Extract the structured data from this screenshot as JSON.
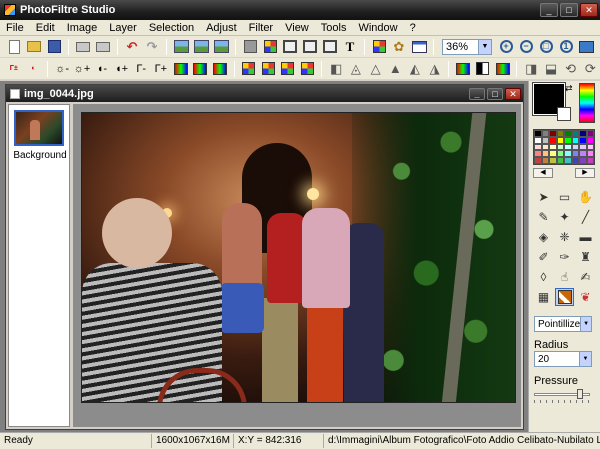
{
  "window": {
    "title": "PhotoFiltre Studio"
  },
  "menu": [
    "File",
    "Edit",
    "Image",
    "Layer",
    "Selection",
    "Adjust",
    "Filter",
    "View",
    "Tools",
    "Window",
    "?"
  ],
  "toolbar": {
    "zoom_value": "36%"
  },
  "document": {
    "title": "img_0044.jpg"
  },
  "layers": [
    {
      "label": "Background"
    }
  ],
  "right_panel": {
    "filter_select": "Pointillize",
    "radius_label": "Radius",
    "radius_value": "20",
    "pressure_label": "Pressure",
    "pressure_level": 0.86,
    "palette": [
      "#000000",
      "#808080",
      "#800000",
      "#808000",
      "#008000",
      "#008080",
      "#000080",
      "#800080",
      "#ffffff",
      "#c0c0c0",
      "#ff0000",
      "#ffff00",
      "#00ff00",
      "#00ffff",
      "#0000ff",
      "#ff00ff",
      "#ffd8d8",
      "#ffe8c8",
      "#ffffc8",
      "#c8ffc8",
      "#c8ffff",
      "#c8d8ff",
      "#e8c8ff",
      "#ffc8ff",
      "#ff8080",
      "#ffc080",
      "#ffff80",
      "#80ff80",
      "#80ffff",
      "#8080ff",
      "#c080ff",
      "#ff80ff",
      "#c04040",
      "#c08040",
      "#c0c040",
      "#40c040",
      "#40c0c0",
      "#4040c0",
      "#8040c0",
      "#c040c0"
    ]
  },
  "status": {
    "state": "Ready",
    "image_info": "1600x1067x16M",
    "coords": "X:Y = 842:316",
    "path": "d:\\Immagini\\Album Fotografico\\Foto Addio Celibato-Nubilato Lalc"
  }
}
